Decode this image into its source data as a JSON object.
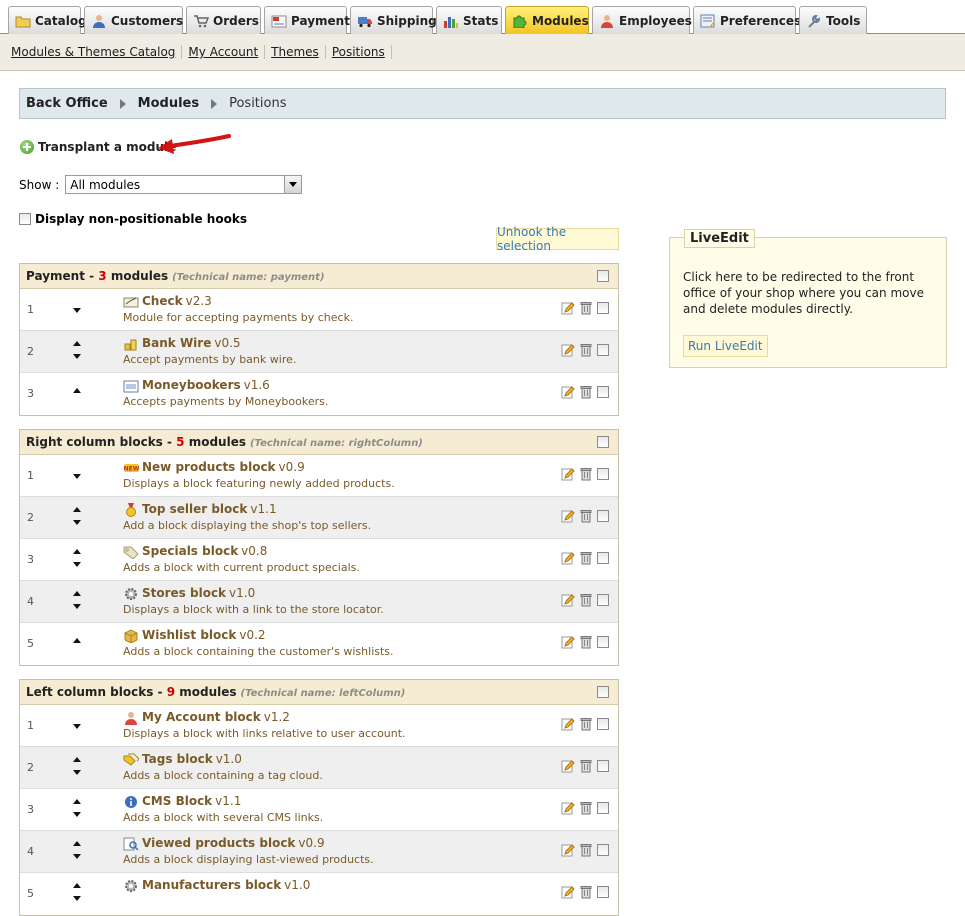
{
  "tabs": [
    {
      "label": "Catalog",
      "icon": "folder-icon",
      "active": false
    },
    {
      "label": "Customers",
      "icon": "customer-icon",
      "active": false
    },
    {
      "label": "Orders",
      "icon": "cart-icon",
      "active": false
    },
    {
      "label": "Payment",
      "icon": "payment-icon",
      "active": false
    },
    {
      "label": "Shipping",
      "icon": "truck-icon",
      "active": false
    },
    {
      "label": "Stats",
      "icon": "stats-icon",
      "active": false
    },
    {
      "label": "Modules",
      "icon": "puzzle-icon",
      "active": true
    },
    {
      "label": "Employees",
      "icon": "employee-icon",
      "active": false
    },
    {
      "label": "Preferences",
      "icon": "preferences-icon",
      "active": false
    },
    {
      "label": "Tools",
      "icon": "wrench-icon",
      "active": false
    }
  ],
  "submenu": [
    "Modules & Themes Catalog",
    "My Account",
    "Themes",
    "Positions"
  ],
  "breadcrumb": {
    "root": "Back Office",
    "section": "Modules",
    "current": "Positions"
  },
  "transplant_label": "Transplant a module",
  "show": {
    "label": "Show :",
    "selected": "All modules"
  },
  "nonpositionable_label": "Display non-positionable hooks",
  "unhook_label": "Unhook the selection",
  "hooks": [
    {
      "title": "Payment",
      "separator": " - ",
      "count": "3",
      "count_suffix": " modules",
      "technical": "(Technical name: payment)",
      "modules": [
        {
          "pos": "1",
          "name": "Check",
          "version": "v2.3",
          "desc": "Module for accepting payments by check.",
          "icon": "check-icon",
          "arrows": "down"
        },
        {
          "pos": "2",
          "name": "Bank Wire",
          "version": "v0.5",
          "desc": "Accept payments by bank wire.",
          "icon": "bank-icon",
          "arrows": "both"
        },
        {
          "pos": "3",
          "name": "Moneybookers",
          "version": "v1.6",
          "desc": "Accepts payments by Moneybookers.",
          "icon": "moneybookers-icon",
          "arrows": "up"
        }
      ]
    },
    {
      "title": "Right column blocks",
      "separator": " - ",
      "count": "5",
      "count_suffix": " modules",
      "technical": "(Technical name: rightColumn)",
      "modules": [
        {
          "pos": "1",
          "name": "New products block",
          "version": "v0.9",
          "desc": "Displays a block featuring newly added products.",
          "icon": "new-badge-icon",
          "arrows": "down"
        },
        {
          "pos": "2",
          "name": "Top seller block",
          "version": "v1.1",
          "desc": "Add a block displaying the shop's top sellers.",
          "icon": "medal-icon",
          "arrows": "both"
        },
        {
          "pos": "3",
          "name": "Specials block",
          "version": "v0.8",
          "desc": "Adds a block with current product specials.",
          "icon": "tag-icon",
          "arrows": "both"
        },
        {
          "pos": "4",
          "name": "Stores block",
          "version": "v1.0",
          "desc": "Displays a block with a link to the store locator.",
          "icon": "gear-icon",
          "arrows": "both"
        },
        {
          "pos": "5",
          "name": "Wishlist block",
          "version": "v0.2",
          "desc": "Adds a block containing the customer's wishlists.",
          "icon": "box-icon",
          "arrows": "up"
        }
      ]
    },
    {
      "title": "Left column blocks",
      "separator": " - ",
      "count": "9",
      "count_suffix": " modules",
      "technical": "(Technical name: leftColumn)",
      "modules": [
        {
          "pos": "1",
          "name": "My Account block",
          "version": "v1.2",
          "desc": "Displays a block with links relative to user account.",
          "icon": "user-icon",
          "arrows": "down"
        },
        {
          "pos": "2",
          "name": "Tags block",
          "version": "v1.0",
          "desc": "Adds a block containing a tag cloud.",
          "icon": "tags-icon",
          "arrows": "both"
        },
        {
          "pos": "3",
          "name": "CMS Block",
          "version": "v1.1",
          "desc": "Adds a block with several CMS links.",
          "icon": "info-icon",
          "arrows": "both"
        },
        {
          "pos": "4",
          "name": "Viewed products block",
          "version": "v0.9",
          "desc": "Adds a block displaying last-viewed products.",
          "icon": "search-doc-icon",
          "arrows": "both"
        },
        {
          "pos": "5",
          "name": "Manufacturers block",
          "version": "v1.0",
          "desc": "",
          "icon": "gear-icon",
          "arrows": "both"
        }
      ]
    }
  ],
  "liveedit": {
    "title": "LiveEdit",
    "text": "Click here to be redirected to the front office of your shop where you can move and delete modules directly.",
    "button": "Run LiveEdit"
  }
}
